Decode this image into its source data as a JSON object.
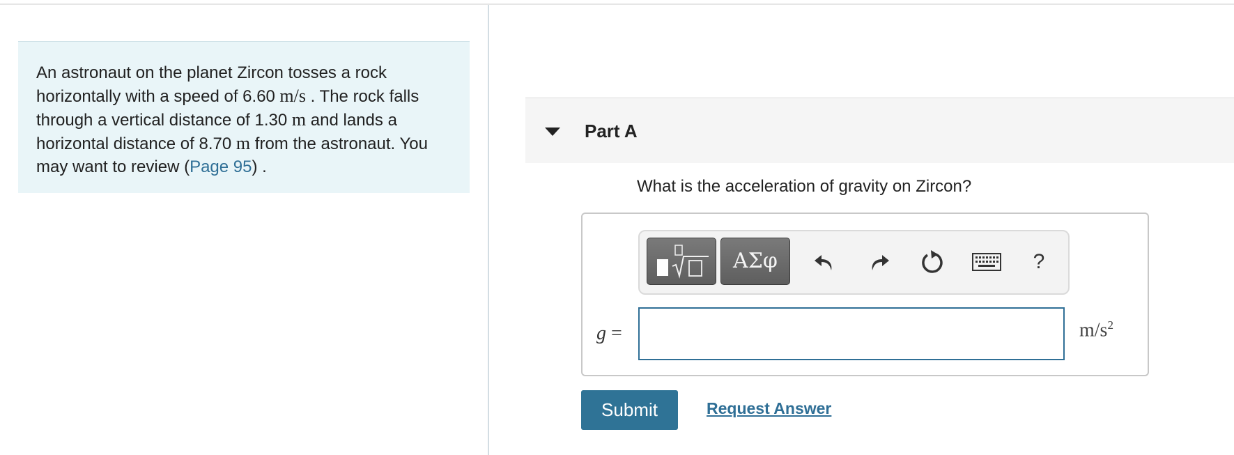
{
  "intro": {
    "text_1": "An astronaut on the planet Zircon tosses a rock horizontally with a speed of ",
    "speed": "6.60",
    "speed_unit": "m/s",
    "text_2": " . The rock falls through a vertical distance of ",
    "vertical_distance": "1.30",
    "distance_unit": "m",
    "text_3": " and lands a horizontal distance of ",
    "horizontal_distance": "8.70",
    "distance_unit_2": "m",
    "text_4": " from the astronaut. You may want to review (",
    "link_label": "Page 95",
    "text_5": ") ."
  },
  "part": {
    "title": "Part A",
    "question": "What is the acceleration of gravity on Zircon?"
  },
  "toolbar": {
    "greek_label": "ΑΣφ",
    "help_label": "?",
    "icons": [
      "templates-icon",
      "greek-letters-icon",
      "undo-icon",
      "redo-icon",
      "reset-icon",
      "keyboard-icon",
      "help-icon"
    ]
  },
  "answer": {
    "variable": "g",
    "equals": " =",
    "value": "",
    "unit_base": "m/s",
    "unit_exp": "2"
  },
  "actions": {
    "submit_label": "Submit",
    "request_label": "Request Answer"
  },
  "colors": {
    "accent": "#2f7396",
    "intro_bg": "#e9f5f8",
    "header_bg": "#f5f5f5"
  }
}
